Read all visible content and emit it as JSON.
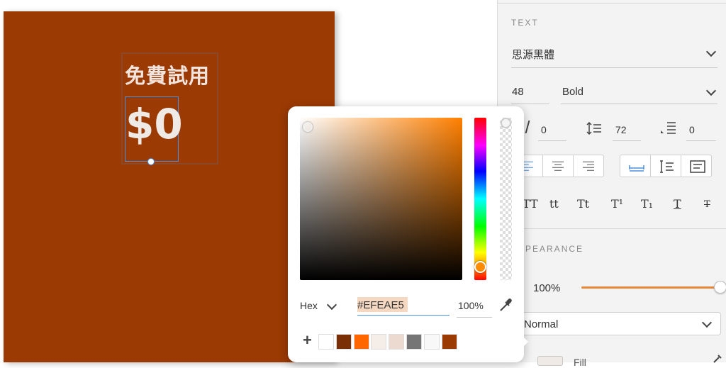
{
  "artboard": {
    "title_text": "免費試用",
    "price_text": "$0",
    "background_color": "#9b3a03",
    "text_color": "#efeae5"
  },
  "inspector": {
    "text_section_label": "TEXT",
    "font_family": "思源黑體",
    "font_size": "48",
    "font_weight": "Bold",
    "character_spacing": "0",
    "line_spacing": "72",
    "paragraph_spacing": "0",
    "text_styles": [
      "TT",
      "tt",
      "Tt",
      "T¹",
      "T₁",
      "T",
      "T"
    ],
    "appearance_label": "APPEARANCE",
    "opacity": "100%",
    "opacity_slider_level": 1.0,
    "blend_mode": "Normal",
    "fill_label": "Fill",
    "accent_color": "#e8883a"
  },
  "color_picker": {
    "format": "Hex",
    "hex_value": "#EFEAE5",
    "opacity": "100%",
    "hue_color": "#ff7f00",
    "swatches": [
      "#ffffff",
      "#7a2f05",
      "#ff6600",
      "#f4ede8",
      "#ecd9d0",
      "#757575",
      "#f8f8f8",
      "#9b3a03"
    ]
  },
  "icons": [
    "chevron-down-icon",
    "character-spacing-icon",
    "line-spacing-icon",
    "paragraph-spacing-icon",
    "align-left-icon",
    "align-center-icon",
    "align-right-icon",
    "fixed-width-icon",
    "auto-height-icon",
    "text-box-icon",
    "eyedropper-icon",
    "add-icon"
  ]
}
